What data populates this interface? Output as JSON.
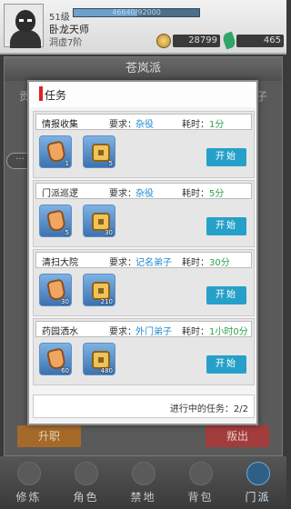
{
  "player": {
    "level": "51级",
    "exp_text": "46640/92000",
    "exp_fraction": 0.51,
    "title": "卧龙天师",
    "realm": "洞虚7阶",
    "coins": "28799",
    "jade": "465"
  },
  "sect": {
    "name": "苍岚派",
    "left_label": "贡",
    "right_label": "子",
    "promote": "升职",
    "defect": "叛出"
  },
  "dialog": {
    "title": "任务",
    "progress": "进行中的任务：2/2"
  },
  "tasks": [
    {
      "name": "情报收集",
      "req_label": "要求：",
      "req": "杂役",
      "time_label": "耗时：",
      "time": "1分",
      "start": "开始",
      "items": [
        {
          "icon": "token-icon",
          "count": "1"
        },
        {
          "icon": "coin-icon",
          "count": "5"
        }
      ]
    },
    {
      "name": "门派巡逻",
      "req_label": "要求：",
      "req": "杂役",
      "time_label": "耗时：",
      "time": "5分",
      "start": "开始",
      "items": [
        {
          "icon": "token-icon",
          "count": "5"
        },
        {
          "icon": "coin-icon",
          "count": "30"
        }
      ]
    },
    {
      "name": "清扫大院",
      "req_label": "要求：",
      "req": "记名弟子",
      "time_label": "耗时：",
      "time": "30分",
      "start": "开始",
      "items": [
        {
          "icon": "token-icon",
          "count": "30"
        },
        {
          "icon": "coin-icon",
          "count": "210"
        }
      ]
    },
    {
      "name": "药园洒水",
      "req_label": "要求：",
      "req": "外门弟子",
      "time_label": "耗时：",
      "time": "1小时0分",
      "start": "开始",
      "items": [
        {
          "icon": "token-icon",
          "count": "60"
        },
        {
          "icon": "coin-icon",
          "count": "480"
        }
      ]
    }
  ],
  "nav": [
    "修炼",
    "角色",
    "禁地",
    "背包",
    "门派"
  ]
}
